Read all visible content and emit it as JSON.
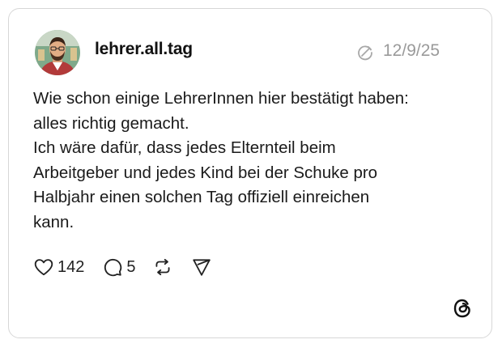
{
  "post": {
    "username": "lehrer.all.tag",
    "timestamp": "12/9/25",
    "body_lines": [
      "Wie schon einige LehrerInnen hier bestätigt haben:",
      "alles richtig gemacht.",
      "Ich wäre dafür, dass jedes Elternteil beim",
      "Arbeitgeber und jedes Kind bei der Schuke pro",
      "Halbjahr einen solchen Tag offiziell einreichen",
      "kann."
    ]
  },
  "actions": {
    "like_count": "142",
    "reply_count": "5"
  },
  "icons": {
    "avatar": "avatar",
    "edited": "edited-icon",
    "like": "heart-icon",
    "reply": "comment-icon",
    "repost": "repost-icon",
    "share": "send-icon",
    "brand": "threads-logo"
  },
  "colors": {
    "text": "#111111",
    "muted": "#9a9a9a",
    "border": "#d7d7d7"
  }
}
